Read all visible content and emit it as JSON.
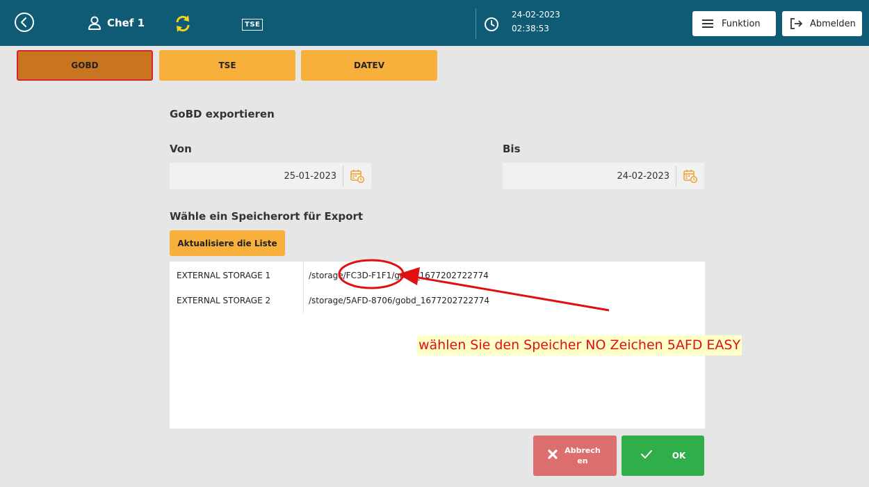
{
  "header": {
    "user_name": "Chef 1",
    "tse_label": "TSE",
    "date": "24-02-2023",
    "time": "02:38:53",
    "funktion_label": "Funktion",
    "abmelden_label": "Abmelden"
  },
  "tabs": [
    {
      "label": "GOBD",
      "active": true
    },
    {
      "label": "TSE",
      "active": false
    },
    {
      "label": "DATEV",
      "active": false
    }
  ],
  "form": {
    "title": "GoBD exportieren",
    "von_label": "Von",
    "von_value": "25-01-2023",
    "bis_label": "Bis",
    "bis_value": "24-02-2023",
    "storage_label": "Wähle ein Speicherort für Export",
    "refresh_label": "Aktualisiere die Liste"
  },
  "storages": [
    {
      "name": "EXTERNAL STORAGE 1",
      "path_prefix": "/storage/",
      "path_highlight": "FC3D-F1F1",
      "path_suffix": "/gobd_1677202722774"
    },
    {
      "name": "EXTERNAL STORAGE 2",
      "path": "/storage/5AFD-8706/gobd_1677202722774"
    }
  ],
  "actions": {
    "cancel_label": "Abbrechen",
    "ok_label": "OK"
  },
  "annotation": {
    "text": "wählen Sie den Speicher NO Zeichen 5AFD EASY"
  },
  "colors": {
    "topbar": "#0f5a74",
    "tab": "#f8b03c",
    "tab_active": "#c9741f",
    "cancel": "#dd6e6e",
    "ok": "#2fae4a",
    "annotation_red": "#e01010"
  },
  "icons": {
    "back": "circle-chevron-left-icon",
    "user": "user-icon",
    "sync": "sync-icon",
    "tse": "tse-icon",
    "clock": "clock-icon",
    "menu": "menu-icon",
    "logout": "logout-icon",
    "calendar": "calendar-icon",
    "cancel": "x-icon",
    "ok": "check-icon"
  }
}
